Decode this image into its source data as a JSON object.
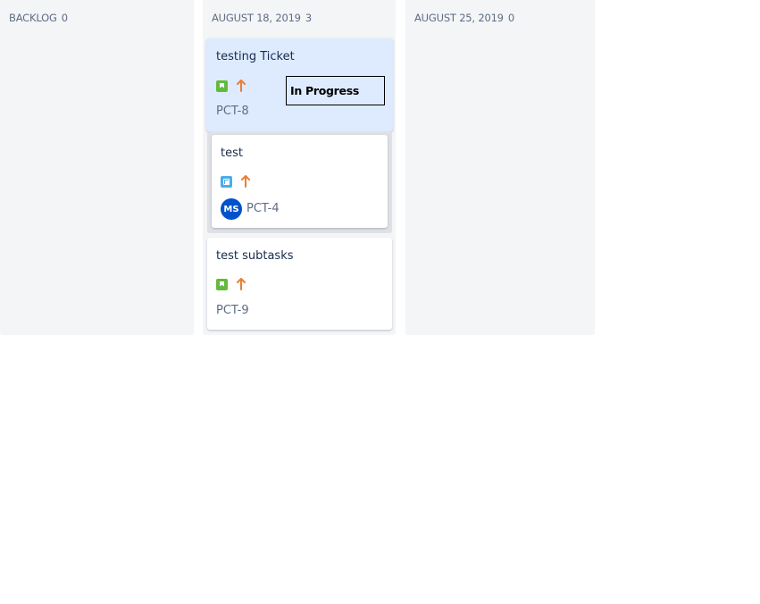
{
  "columns": [
    {
      "title": "BACKLOG",
      "count": "0",
      "cards": []
    },
    {
      "title": "AUGUST 18, 2019",
      "count": "3",
      "cards": [
        {
          "title": "testing Ticket",
          "key": "PCT-8",
          "type_icon": "story-icon",
          "priority_icon": "priority-high-arrow-up-icon",
          "status_overlay": "In Progress",
          "selected": true
        },
        {
          "title": "test",
          "key": "PCT-4",
          "type_icon": "subtask-icon",
          "priority_icon": "priority-high-arrow-up-icon",
          "assignee_initials": "MS"
        },
        {
          "title": "test subtasks",
          "key": "PCT-9",
          "type_icon": "story-icon",
          "priority_icon": "priority-high-arrow-up-icon"
        }
      ]
    },
    {
      "title": "AUGUST 25, 2019",
      "count": "0",
      "cards": []
    }
  ],
  "colors": {
    "column_bg": "#f4f5f7",
    "selected_card_bg": "#deebff",
    "story_green": "#63ba3c",
    "subtask_blue": "#4bade8",
    "priority_orange": "#e97f33",
    "avatar_blue": "#0052cc"
  }
}
